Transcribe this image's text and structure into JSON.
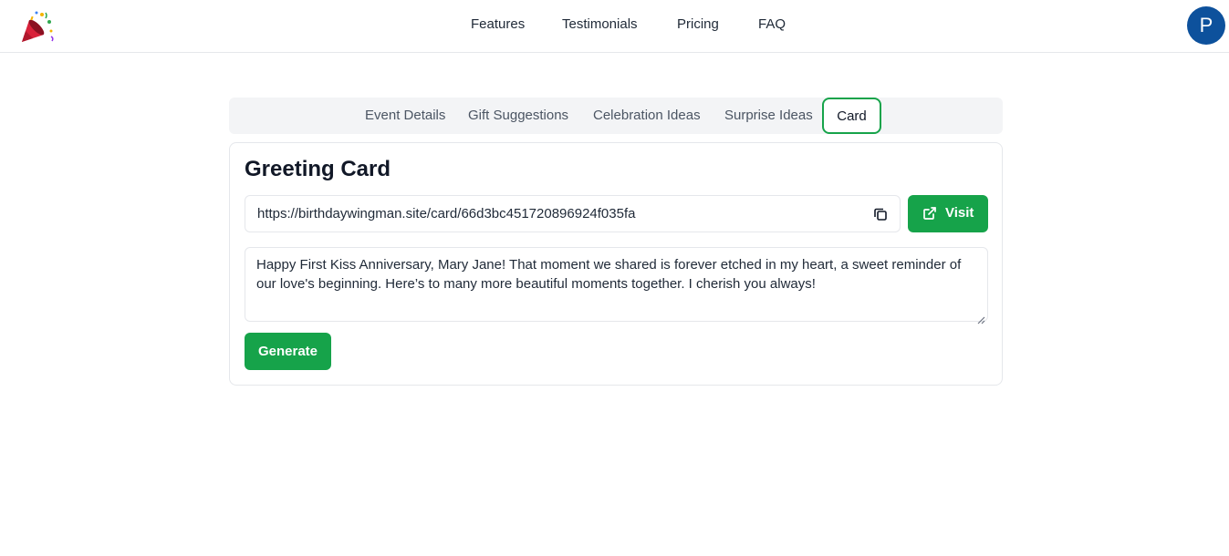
{
  "header": {
    "logo_icon": "party-popper-icon",
    "nav": [
      "Features",
      "Testimonials",
      "Pricing",
      "FAQ"
    ],
    "avatar_initial": "P",
    "avatar_color": "#0d519c"
  },
  "tabs": [
    {
      "label": "Event Details",
      "active": false
    },
    {
      "label": "Gift Suggestions",
      "active": false
    },
    {
      "label": "Celebration Ideas",
      "active": false
    },
    {
      "label": "Surprise Ideas",
      "active": false
    },
    {
      "label": "Card",
      "active": true
    }
  ],
  "card": {
    "title": "Greeting Card",
    "url": "https://birthdaywingman.site/card/66d3bc451720896924f035fa",
    "copy_icon": "copy-icon",
    "visit_label": "Visit",
    "visit_icon": "external-link-icon",
    "message": "Happy First Kiss Anniversary, Mary Jane! That moment we shared is forever etched in my heart, a sweet reminder of our love's beginning. Here’s to many more beautiful moments together. I cherish you always!",
    "generate_label": "Generate"
  },
  "colors": {
    "accent": "#16a34a",
    "tab_bar": "#f3f4f6",
    "border": "#e5e7eb"
  }
}
